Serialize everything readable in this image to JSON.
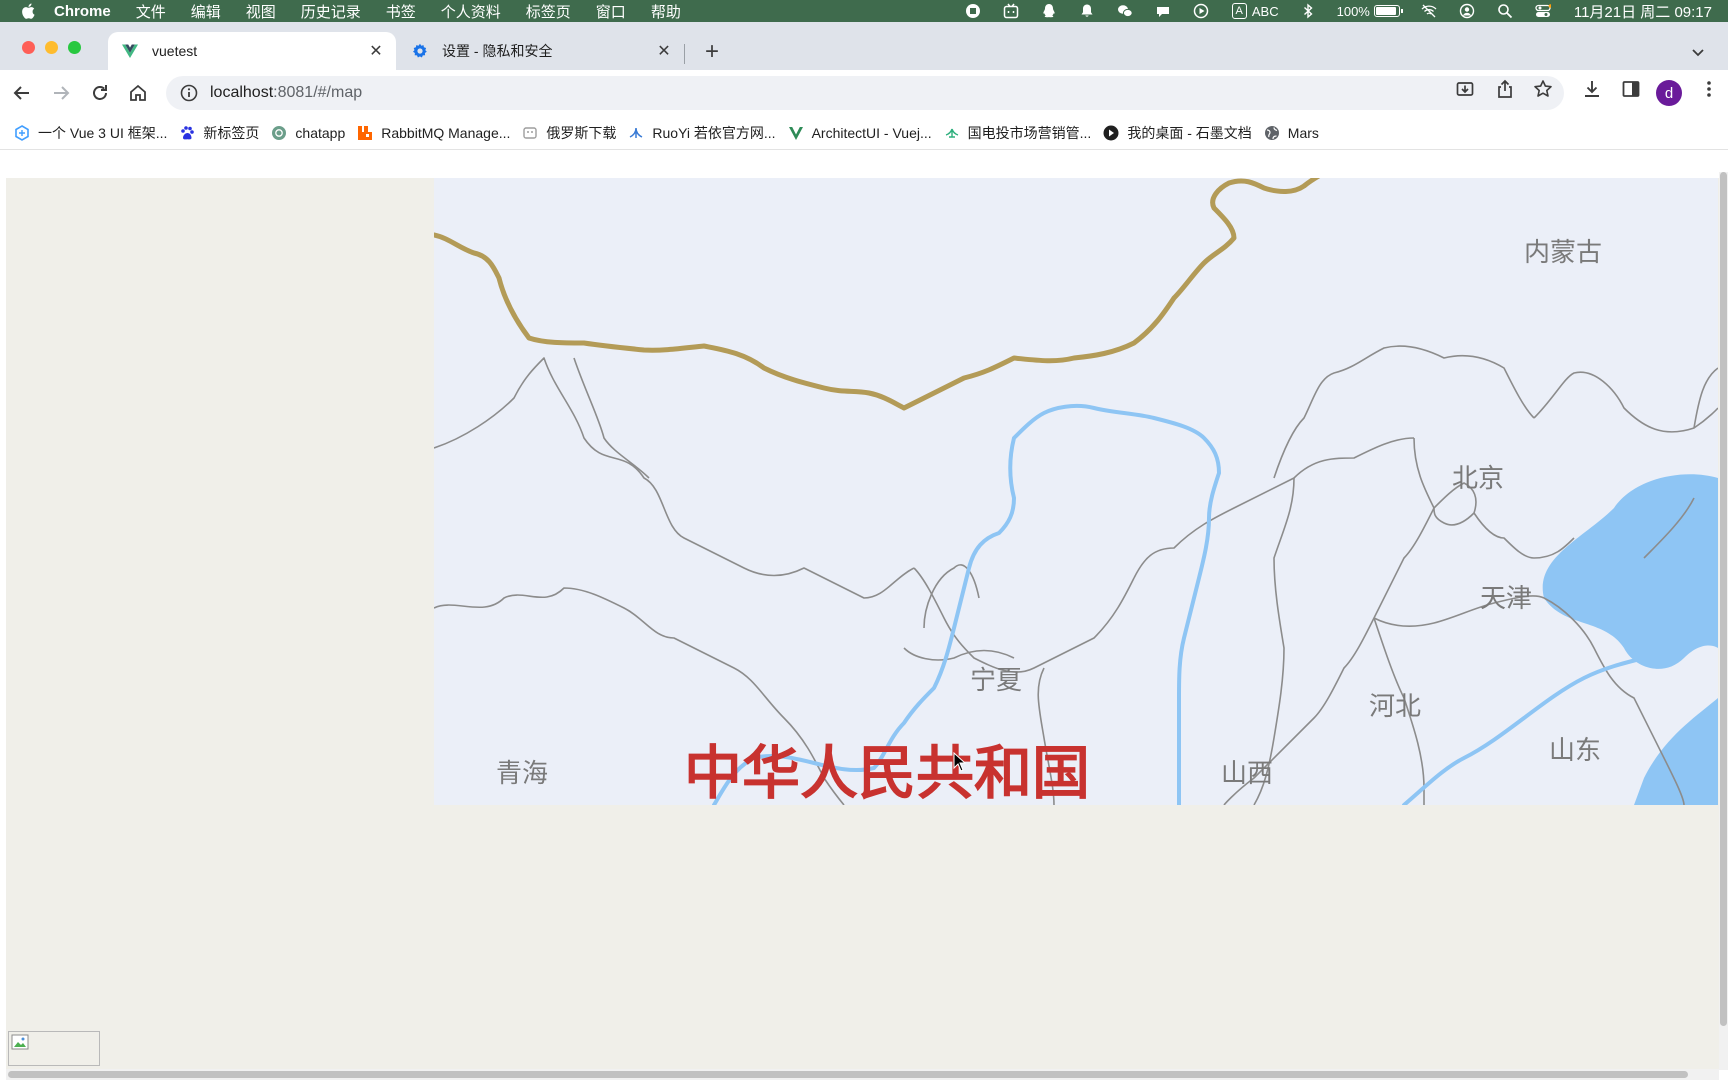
{
  "menubar": {
    "app_name": "Chrome",
    "items": [
      "文件",
      "编辑",
      "视图",
      "历史记录",
      "书签",
      "个人资料",
      "标签页",
      "窗口",
      "帮助"
    ],
    "input_method": "ABC",
    "input_badge": "A",
    "battery": "100%",
    "battery_level": 1.0,
    "clock": "11月21日 周二  09:17"
  },
  "tabs": [
    {
      "title": "vuetest",
      "active": true,
      "favicon": "vue-logo-icon"
    },
    {
      "title": "设置 - 隐私和安全",
      "active": false,
      "favicon": "settings-gear-icon"
    }
  ],
  "toolbar": {
    "url_host": "localhost",
    "url_rest": ":8081/#/map",
    "profile_initial": "d"
  },
  "bookmarks": [
    {
      "label": "一个 Vue 3 UI 框架...",
      "icon": "element-plus-icon",
      "color": "#409eff"
    },
    {
      "label": "新标签页",
      "icon": "baidu-paw-icon",
      "color": "#2932e1"
    },
    {
      "label": "chatapp",
      "icon": "chatgpt-icon",
      "color": "#6b9e8a"
    },
    {
      "label": "RabbitMQ Manage...",
      "icon": "rabbitmq-icon",
      "color": "#ff6600"
    },
    {
      "label": "俄罗斯下载",
      "icon": "russia-site-icon",
      "color": "#9e9e9e"
    },
    {
      "label": "RuoYi 若依官方网...",
      "icon": "ruoyi-leaf-icon",
      "color": "#3a7bd5"
    },
    {
      "label": "ArchitectUI - Vuej...",
      "icon": "vue-logo-icon",
      "color": "#2e8b57"
    },
    {
      "label": "国电投市场营销管...",
      "icon": "spic-leaf-icon",
      "color": "#2eaf7d"
    },
    {
      "label": "我的桌面 - 石墨文档",
      "icon": "shimo-icon",
      "color": "#1f1f1f"
    },
    {
      "label": "Mars",
      "icon": "globe-icon",
      "color": "#5f6368"
    }
  ],
  "map": {
    "labels": {
      "inner_mongolia": "内蒙古",
      "beijing": "北京",
      "tianjin": "天津",
      "ningxia": "宁夏",
      "hebei": "河北",
      "qinghai": "青海",
      "shanxi": "山西",
      "shandong": "山东",
      "country": "中华人民共和国"
    },
    "colors": {
      "land": "#ebeff8",
      "water": "#8ec5f4",
      "border_national": "#b39b57",
      "border_province": "#8c8c8c",
      "river": "#8ec5f4",
      "country_label": "#c8322f"
    }
  }
}
